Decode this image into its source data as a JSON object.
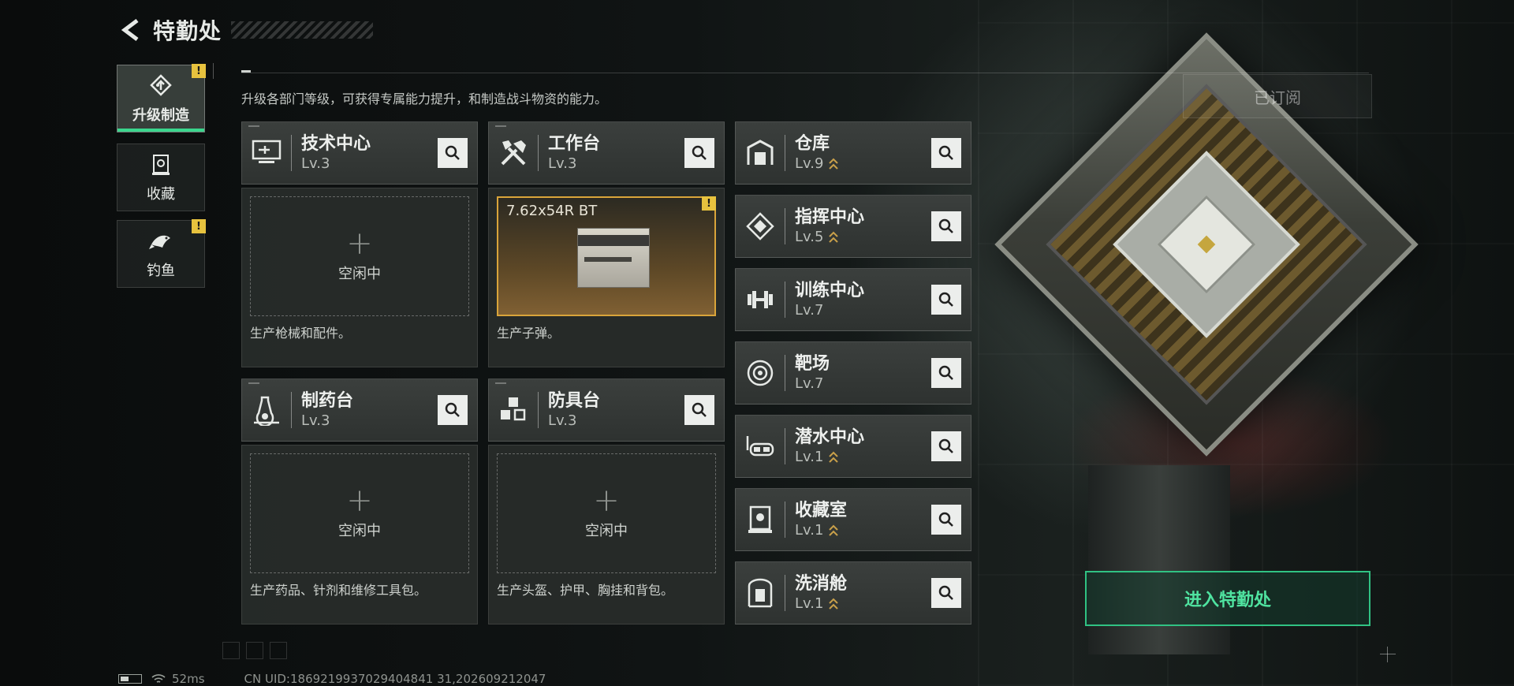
{
  "header": {
    "title": "特勤处",
    "back_icon": "back-arrow-icon"
  },
  "description": "升级各部门等级，可获得专属能力提升，和制造战斗物资的能力。",
  "subscribed_label": "已订阅",
  "side_tabs": [
    {
      "label": "升级制造",
      "icon": "upgrade-craft-icon",
      "active": true,
      "warning": true
    },
    {
      "label": "收藏",
      "icon": "collection-icon",
      "active": false,
      "warning": false
    },
    {
      "label": "钓鱼",
      "icon": "fish-icon",
      "active": false,
      "warning": true
    }
  ],
  "warning_glyph": "!",
  "facilities": [
    {
      "name": "技术中心",
      "level": "Lv.3",
      "icon": "tech-center-icon",
      "slot_idle": "空闲中",
      "desc": "生产枪械和配件。"
    },
    {
      "name": "工作台",
      "level": "Lv.3",
      "icon": "workbench-icon",
      "active_item": "7.62x54R BT",
      "desc": "生产子弹。"
    },
    {
      "name": "制药台",
      "level": "Lv.3",
      "icon": "pharmacy-icon",
      "slot_idle": "空闲中",
      "desc": "生产药品、针剂和维修工具包。"
    },
    {
      "name": "防具台",
      "level": "Lv.3",
      "icon": "armor-bench-icon",
      "slot_idle": "空闲中",
      "desc": "生产头盔、护甲、胸挂和背包。"
    }
  ],
  "right_facilities": [
    {
      "name": "仓库",
      "level": "Lv.9",
      "icon": "warehouse-icon"
    },
    {
      "name": "指挥中心",
      "level": "Lv.5",
      "icon": "command-center-icon"
    },
    {
      "name": "训练中心",
      "level": "Lv.7",
      "icon": "training-center-icon"
    },
    {
      "name": "靶场",
      "level": "Lv.7",
      "icon": "shooting-range-icon"
    },
    {
      "name": "潜水中心",
      "level": "Lv.1",
      "icon": "diving-center-icon"
    },
    {
      "name": "收藏室",
      "level": "Lv.1",
      "icon": "collection-room-icon"
    },
    {
      "name": "洗消舱",
      "level": "Lv.1",
      "icon": "decontamination-icon"
    }
  ],
  "enter_button": "进入特勤处",
  "footer": {
    "ping": "52ms",
    "uid": "CN UID:1869219937029404841 31,202609212047"
  },
  "colors": {
    "accent_green": "#30c283",
    "warning_yellow": "#e7c23e",
    "active_slot_border": "#d9a43a"
  }
}
